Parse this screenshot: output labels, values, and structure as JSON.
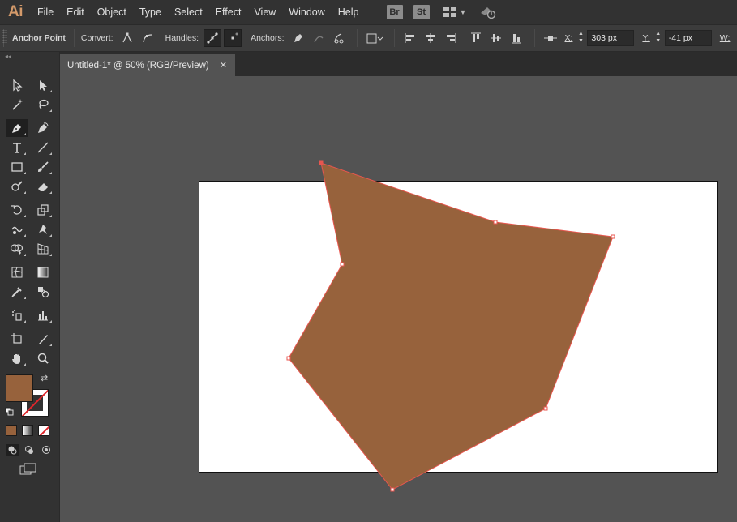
{
  "app": {
    "logo": "Ai"
  },
  "menu": [
    "File",
    "Edit",
    "Object",
    "Type",
    "Select",
    "Effect",
    "View",
    "Window",
    "Help"
  ],
  "bridge": {
    "br": "Br",
    "st": "St"
  },
  "control": {
    "title": "Anchor Point",
    "convert_label": "Convert:",
    "handles_label": "Handles:",
    "anchors_label": "Anchors:",
    "x_label": "X:",
    "x_value": "303 px",
    "y_label": "Y:",
    "y_value": "-41 px",
    "w_label": "W:"
  },
  "toolbar": {
    "collapse_glyph": "◂◂"
  },
  "document": {
    "tab_title": "Untitled-1* @ 50% (RGB/Preview)",
    "close_glyph": "✕"
  },
  "colors": {
    "fill": "#97623c",
    "path_stroke": "#e8564f",
    "artboard": "#ffffff",
    "stroke_none": "#e0262b"
  },
  "icons": {
    "tools": [
      "selection-icon",
      "direct-selection-icon",
      "magic-wand-icon",
      "lasso-icon",
      "pen-icon",
      "curvature-icon",
      "type-icon",
      "line-segment-icon",
      "rectangle-icon",
      "paintbrush-icon",
      "shaper-icon",
      "eraser-icon",
      "rotate-icon",
      "scale-icon",
      "warp-icon",
      "puppet-warp-icon",
      "free-transform-icon",
      "shape-builder-icon",
      "perspective-grid-icon",
      "mesh-icon",
      "gradient-icon",
      "eyedropper-icon",
      "blend-icon",
      "symbol-sprayer-icon",
      "column-graph-icon",
      "artboard-icon",
      "slice-icon",
      "hand-icon",
      "zoom-icon"
    ]
  }
}
